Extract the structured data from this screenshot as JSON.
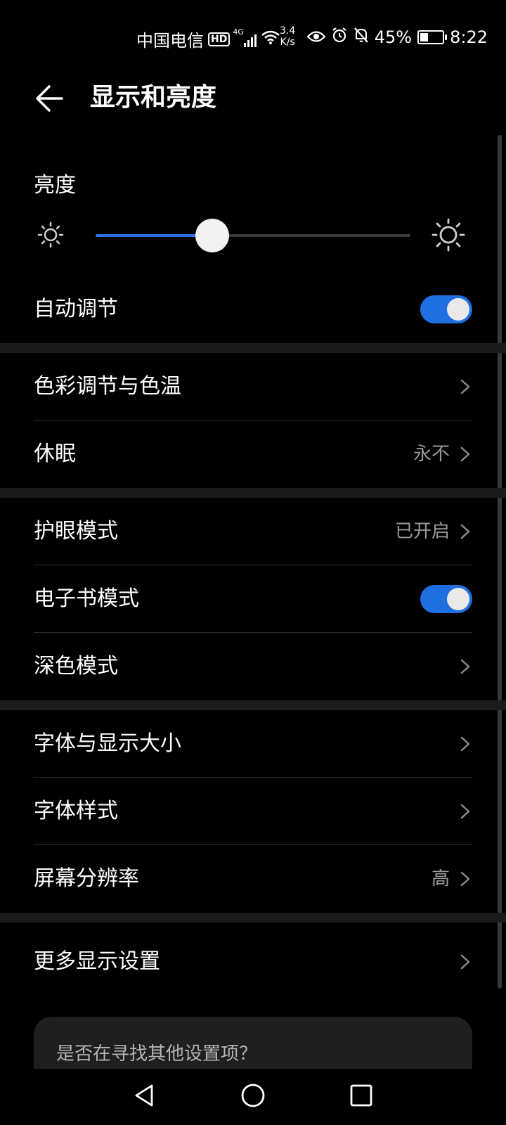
{
  "status_bar": {
    "carrier": "中国电信",
    "hd_badge": "HD",
    "signal_label": "4G",
    "net_speed_value": "3.4",
    "net_speed_unit": "K/s",
    "battery_percent": "45%",
    "battery_level": 0.45,
    "time": "8:22"
  },
  "header": {
    "title": "显示和亮度"
  },
  "brightness": {
    "label": "亮度",
    "level": 0.37
  },
  "auto_adjust": {
    "label": "自动调节",
    "enabled": true
  },
  "rows": {
    "color_temp": {
      "label": "色彩调节与色温"
    },
    "sleep": {
      "label": "休眠",
      "value": "永不"
    },
    "eye_comfort": {
      "label": "护眼模式",
      "value": "已开启"
    },
    "ebook_mode": {
      "label": "电子书模式",
      "enabled": true
    },
    "dark_mode": {
      "label": "深色模式"
    },
    "font_display_size": {
      "label": "字体与显示大小"
    },
    "font_style": {
      "label": "字体样式"
    },
    "screen_resolution": {
      "label": "屏幕分辨率",
      "value": "高"
    },
    "more_display": {
      "label": "更多显示设置"
    }
  },
  "suggestion": {
    "text": "是否在寻找其他设置项？"
  },
  "colors": {
    "accent": "#1f6fe0",
    "background": "#000000",
    "section_gap": "#1b1b1b",
    "secondary_text": "#9a9a9a"
  },
  "icons": {
    "back": "arrow-left-icon",
    "chevron": "chevron-right-icon",
    "sun_small": "sun-small-icon",
    "sun_large": "sun-large-icon",
    "eye": "eye-icon",
    "alarm": "alarm-icon",
    "mute": "bell-off-icon",
    "wifi": "wifi-icon",
    "signal": "signal-icon",
    "battery": "battery-charging-icon",
    "nav_back": "triangle-back-icon",
    "nav_home": "circle-home-icon",
    "nav_recent": "square-recent-icon"
  }
}
